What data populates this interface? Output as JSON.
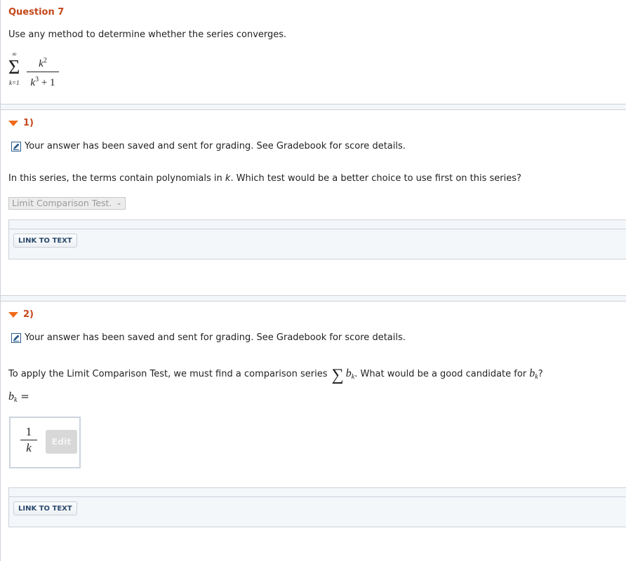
{
  "question": {
    "title": "Question 7",
    "prompt": "Use any method to determine whether the series converges.",
    "series": {
      "upper_limit": "∞",
      "sigma": "Σ",
      "lower_limit": "k=1",
      "numerator_base": "k",
      "numerator_exp": "2",
      "denominator_base": "k",
      "denominator_exp": "3",
      "denominator_rest": " + 1"
    }
  },
  "parts": [
    {
      "label": "1)",
      "saved_message": "Your answer has been saved and sent for grading. See Gradebook for score details.",
      "question_pre": "In this series, the terms contain polynomials in ",
      "question_var": "k",
      "question_post": ". Which test would be a better choice to use first on this series?",
      "select_value": "Limit Comparison Test.",
      "link_button": "LINK TO TEXT"
    },
    {
      "label": "2)",
      "saved_message": "Your answer has been saved and sent for grading. See Gradebook for score details.",
      "question_pre": "To apply the Limit Comparison Test, we must find a comparison series ",
      "sum_symbol": "∑",
      "b_var": "b",
      "b_sub": "k",
      "question_mid": ". What would be a good candidate for ",
      "question_post": "?",
      "answer_label_var": "b",
      "answer_label_sub": "k",
      "answer_label_eq": " =",
      "answer_numerator": "1",
      "answer_denominator": "k",
      "edit_button": "Edit",
      "link_button": "LINK TO TEXT"
    }
  ],
  "colors": {
    "accent": "#c4471a",
    "triangle": "#f06a18",
    "border": "#ccd1d9",
    "panel_bg": "#f4f7fa"
  }
}
